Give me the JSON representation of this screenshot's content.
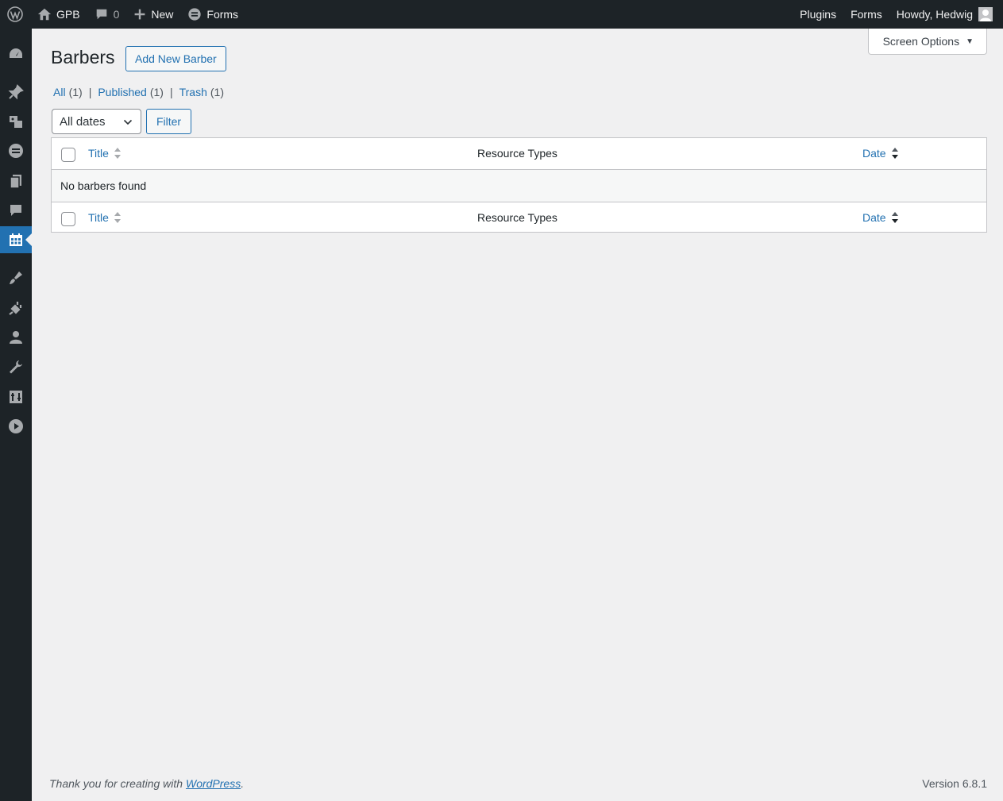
{
  "adminbar": {
    "site_name": "GPB",
    "comments_count": "0",
    "new_label": "New",
    "forms_label": "Forms",
    "plugins_label": "Plugins",
    "forms_right_label": "Forms",
    "howdy": "Howdy, Hedwig"
  },
  "sidebar": {
    "items": [
      {
        "icon": "dashboard-icon"
      },
      {
        "icon": "pin-icon"
      },
      {
        "icon": "media-icon"
      },
      {
        "icon": "forms-icon"
      },
      {
        "icon": "pages-icon"
      },
      {
        "icon": "comments-icon"
      },
      {
        "icon": "calendar-icon",
        "current": true
      },
      {
        "icon": "appearance-icon"
      },
      {
        "icon": "plugins-icon"
      },
      {
        "icon": "users-icon"
      },
      {
        "icon": "tools-icon"
      },
      {
        "icon": "settings-icon"
      },
      {
        "icon": "play-icon"
      }
    ]
  },
  "header": {
    "screen_options": "Screen Options",
    "title": "Barbers",
    "add_new": "Add New Barber"
  },
  "views": {
    "all": {
      "label": "All",
      "count": "(1)"
    },
    "published": {
      "label": "Published",
      "count": "(1)"
    },
    "trash": {
      "label": "Trash",
      "count": "(1)"
    },
    "separator": "|"
  },
  "filters": {
    "date_selected": "All dates",
    "filter_button": "Filter"
  },
  "table": {
    "columns": {
      "title": "Title",
      "resource_types": "Resource Types",
      "date": "Date"
    },
    "empty_message": "No barbers found"
  },
  "footer": {
    "thanks_prefix": "Thank you for creating with ",
    "thanks_link": "WordPress",
    "thanks_suffix": ".",
    "version": "Version 6.8.1"
  },
  "colors": {
    "adminbar_bg": "#1d2327",
    "accent": "#2271b1",
    "page_bg": "#f0f0f1"
  }
}
